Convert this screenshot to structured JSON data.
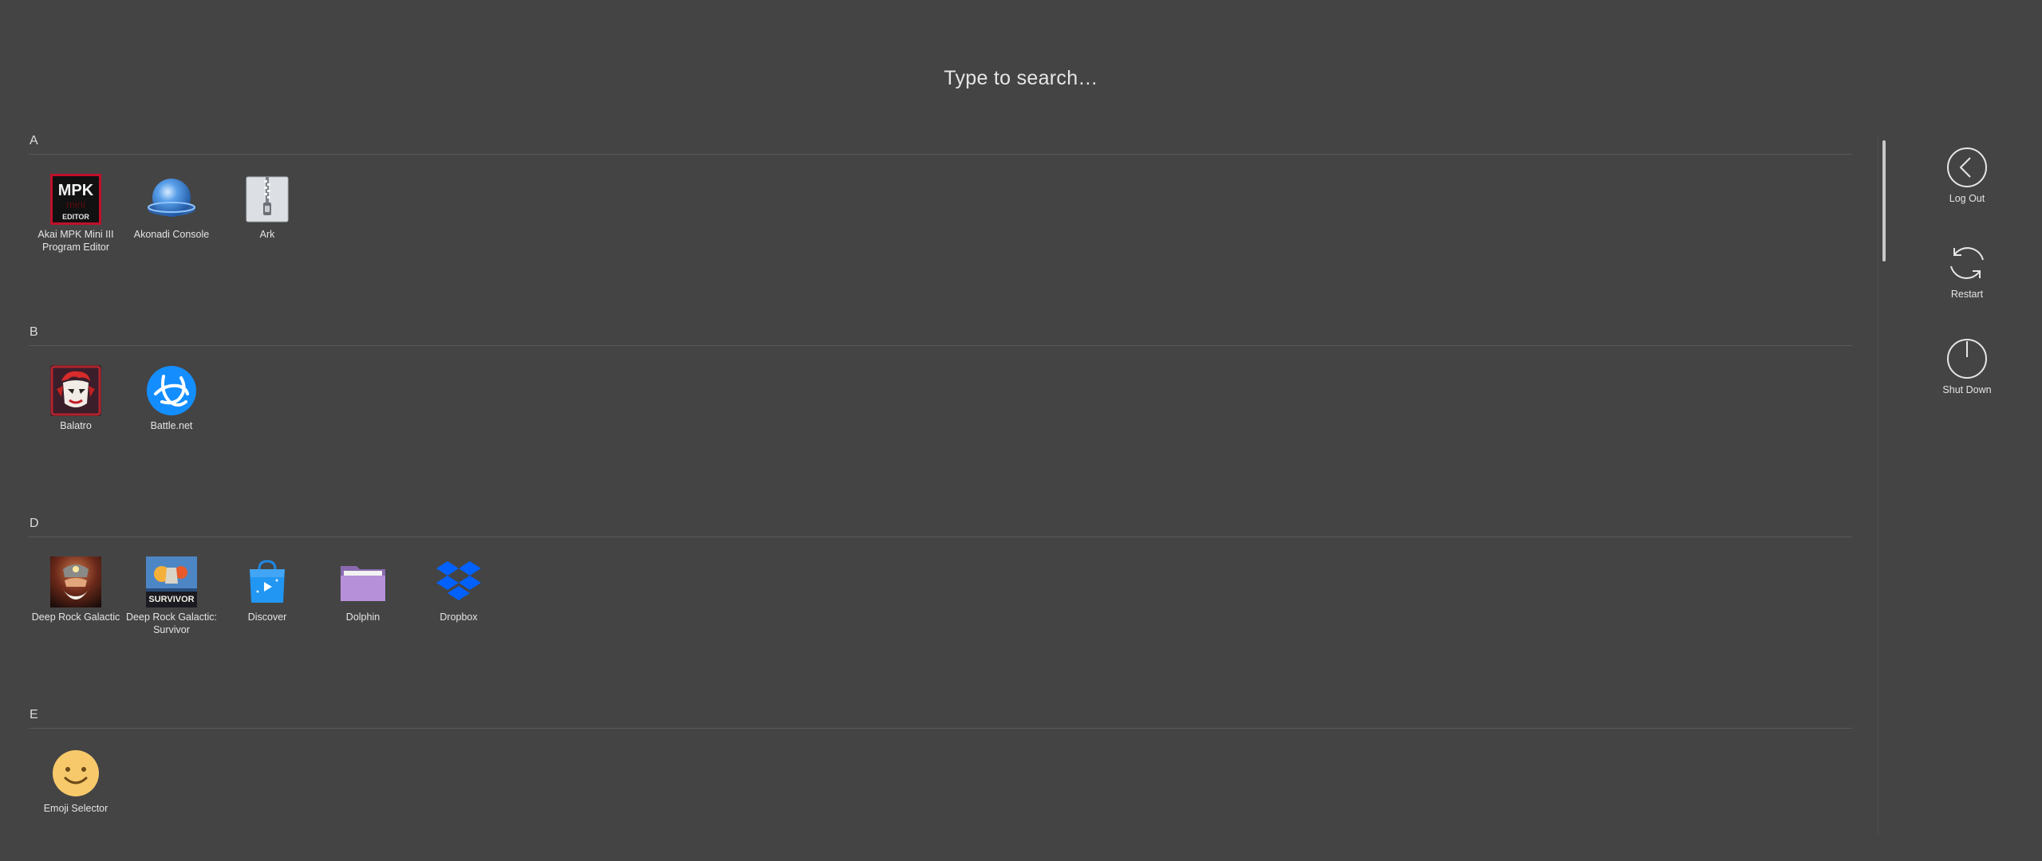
{
  "search": {
    "placeholder": "Type to search…"
  },
  "sections": [
    {
      "letter": "A",
      "apps": [
        {
          "name": "Akai MPK Mini III Program Editor",
          "line1": "Akai MPK Mini III",
          "line2": "Program Editor",
          "icon": "mpk-editor-icon"
        },
        {
          "name": "Akonadi Console",
          "line1": "Akonadi Console",
          "line2": "",
          "icon": "akonadi-icon"
        },
        {
          "name": "Ark",
          "line1": "Ark",
          "line2": "",
          "icon": "ark-zip-icon"
        }
      ]
    },
    {
      "letter": "B",
      "apps": [
        {
          "name": "Balatro",
          "line1": "Balatro",
          "line2": "",
          "icon": "balatro-icon"
        },
        {
          "name": "Battle.net",
          "line1": "Battle.net",
          "line2": "",
          "icon": "battlenet-icon"
        }
      ]
    },
    {
      "letter": "D",
      "apps": [
        {
          "name": "Deep Rock Galactic",
          "line1": "Deep Rock Galactic",
          "line2": "",
          "icon": "deep-rock-galactic-icon"
        },
        {
          "name": "Deep Rock Galactic: Survivor",
          "line1": "Deep Rock Galactic:",
          "line2": "Survivor",
          "icon": "drg-survivor-icon"
        },
        {
          "name": "Discover",
          "line1": "Discover",
          "line2": "",
          "icon": "discover-icon"
        },
        {
          "name": "Dolphin",
          "line1": "Dolphin",
          "line2": "",
          "icon": "dolphin-folder-icon"
        },
        {
          "name": "Dropbox",
          "line1": "Dropbox",
          "line2": "",
          "icon": "dropbox-icon"
        }
      ]
    },
    {
      "letter": "E",
      "apps": [
        {
          "name": "Emoji Selector",
          "line1": "Emoji Selector",
          "line2": "",
          "icon": "emoji-selector-icon"
        }
      ]
    }
  ],
  "icon_text": {
    "mpk_top": "MPK",
    "mpk_mid": "mini",
    "mpk_bottom": "EDITOR",
    "drg_survivor": "SURVIVOR"
  },
  "power": [
    {
      "label": "Log Out",
      "icon": "log-out-icon"
    },
    {
      "label": "Restart",
      "icon": "restart-icon"
    },
    {
      "label": "Shut Down",
      "icon": "shut-down-icon"
    }
  ],
  "colors": {
    "background": "#444444",
    "text": "#e4e4e4",
    "divider": "#5a5a5a"
  }
}
